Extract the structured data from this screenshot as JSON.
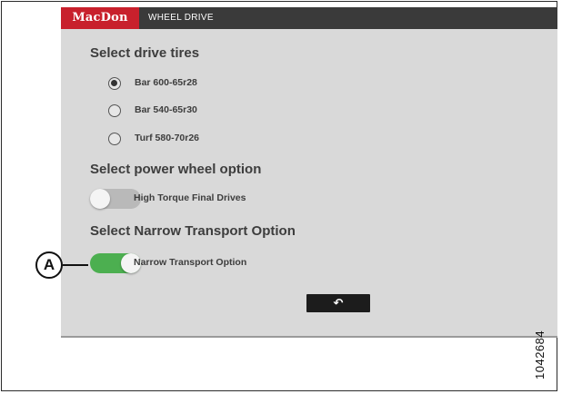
{
  "header": {
    "logo": "MacDon",
    "title": "WHEEL DRIVE"
  },
  "tires": {
    "title": "Select drive tires",
    "options": [
      {
        "label": "Bar 600-65r28",
        "selected": true
      },
      {
        "label": "Bar 540-65r30",
        "selected": false
      },
      {
        "label": "Turf 580-70r26",
        "selected": false
      }
    ]
  },
  "power_wheel": {
    "title": "Select power wheel option",
    "toggle_label": "High Torque Final Drives",
    "enabled": false
  },
  "narrow_transport": {
    "title": "Select Narrow Transport Option",
    "toggle_label": "Narrow Transport Option",
    "enabled": true
  },
  "back_button": {
    "icon": "back-arrow-icon",
    "glyph": "↶"
  },
  "callout": {
    "label": "A"
  },
  "figure_number": "1042684",
  "colors": {
    "brand": "#c8202c",
    "header": "#3a3a3a",
    "toggle_on": "#4caf50",
    "toggle_off": "#b9b9b9",
    "screen_bg": "#d9d9d9"
  }
}
